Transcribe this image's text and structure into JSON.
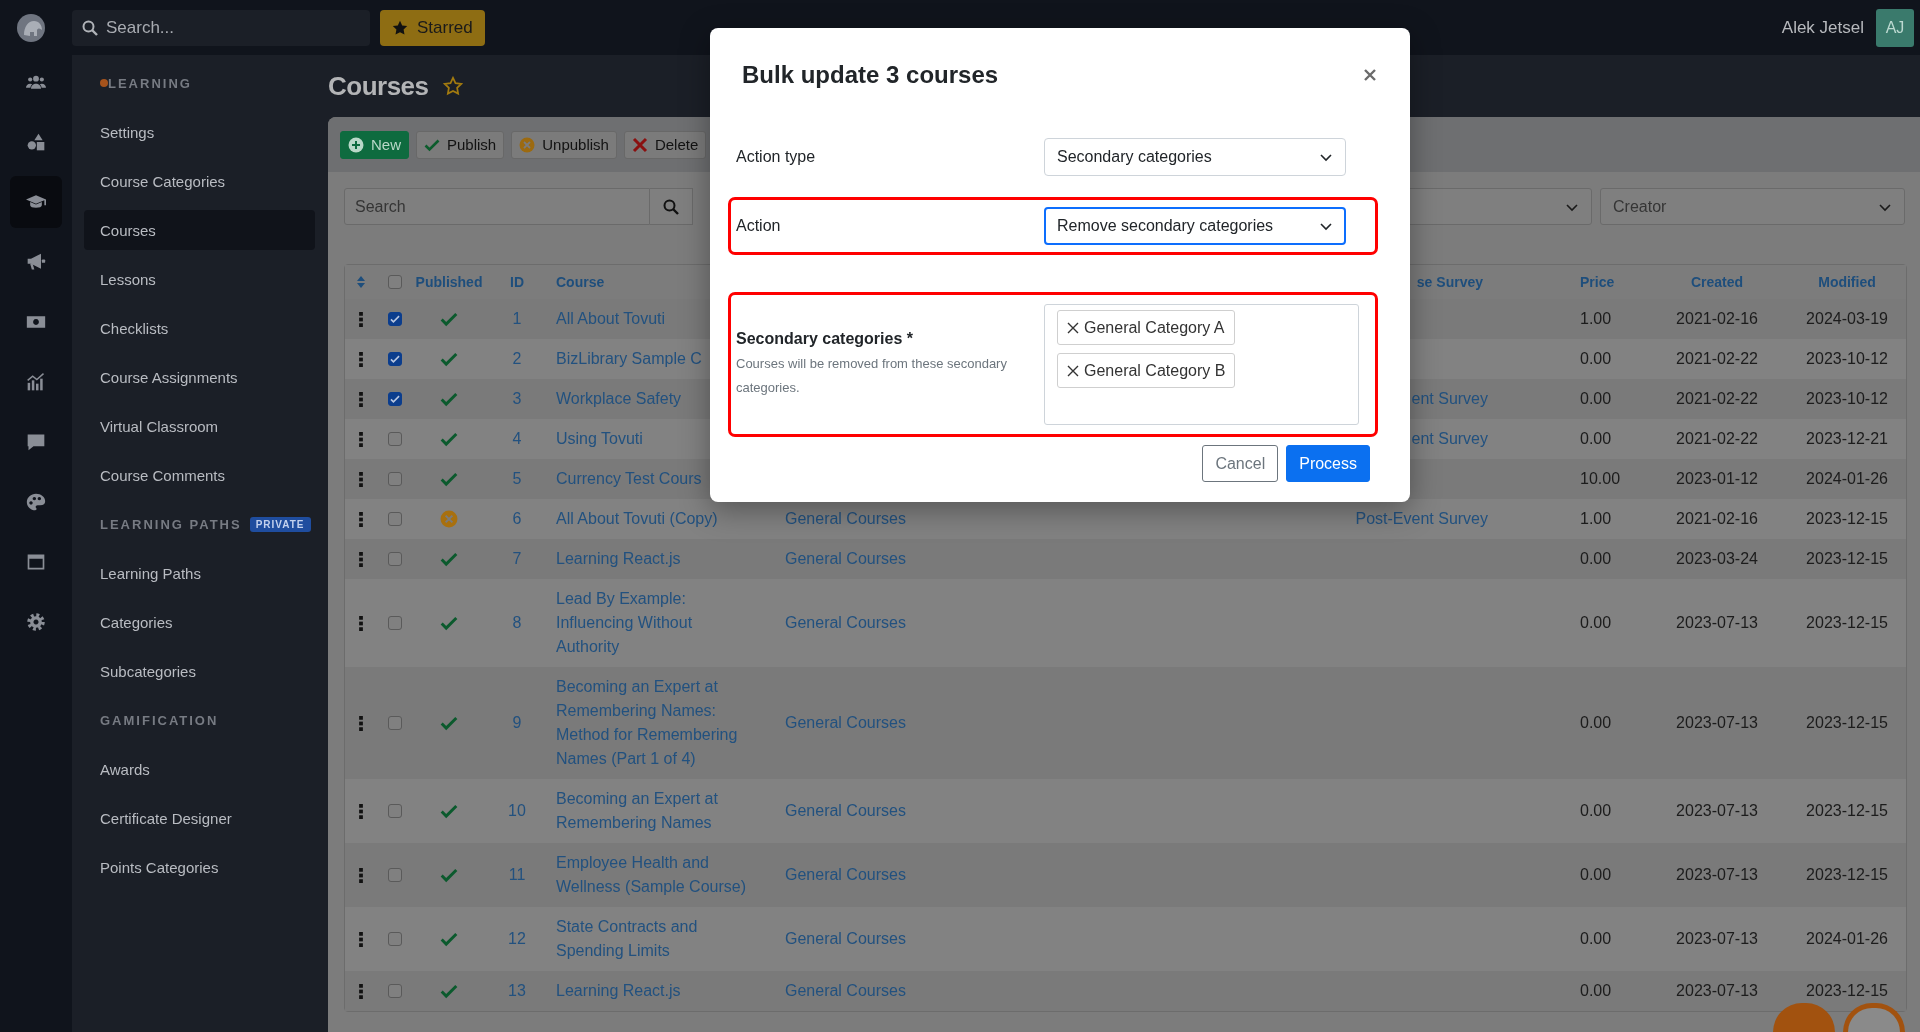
{
  "topbar": {
    "search_placeholder": "Search...",
    "starred_button": "Starred",
    "user_name": "Alek Jetsel",
    "user_initials": "AJ"
  },
  "rail": [
    {
      "selected": false
    },
    {
      "selected": false
    },
    {
      "selected": true
    },
    {
      "selected": false
    },
    {
      "selected": false
    },
    {
      "selected": false
    },
    {
      "selected": false
    },
    {
      "selected": false
    },
    {
      "selected": false
    },
    {
      "selected": false
    }
  ],
  "sidebar": {
    "sections": [
      {
        "heading": "LEARNING",
        "current": true,
        "items": [
          {
            "label": "Settings",
            "selected": false
          },
          {
            "label": "Course Categories",
            "selected": false
          },
          {
            "label": "Courses",
            "selected": true
          },
          {
            "label": "Lessons",
            "selected": false
          },
          {
            "label": "Checklists",
            "selected": false
          },
          {
            "label": "Course Assignments",
            "selected": false
          },
          {
            "label": "Virtual Classroom",
            "selected": false
          },
          {
            "label": "Course Comments",
            "selected": false
          }
        ]
      },
      {
        "heading": "LEARNING PATHS",
        "badge": "PRIVATE",
        "current": false,
        "items": [
          {
            "label": "Learning Paths",
            "selected": false
          },
          {
            "label": "Categories",
            "selected": false
          },
          {
            "label": "Subcategories",
            "selected": false
          }
        ]
      },
      {
        "heading": "GAMIFICATION",
        "current": false,
        "items": [
          {
            "label": "Awards",
            "selected": false
          },
          {
            "label": "Certificate Designer",
            "selected": false
          },
          {
            "label": "Points Categories",
            "selected": false
          }
        ]
      }
    ]
  },
  "page": {
    "title": "Courses"
  },
  "toolbar": [
    {
      "label": "New",
      "kind": "new"
    },
    {
      "label": "Publish",
      "kind": "publish"
    },
    {
      "label": "Unpublish",
      "kind": "unpublish"
    },
    {
      "label": "Delete",
      "kind": "delete"
    }
  ],
  "filters": {
    "search_placeholder": "Search",
    "creator_placeholder": "Creator"
  },
  "table": {
    "select_all": {
      "checked": false
    },
    "columns": {
      "published": "Published",
      "id": "ID",
      "course": "Course",
      "survey": "se Survey",
      "price": "Price",
      "created": "Created",
      "modified": "Modified"
    },
    "rows": [
      {
        "checked": true,
        "published": true,
        "id": "1",
        "course": "All About Tovuti",
        "price": "1.00",
        "created": "2021-02-16",
        "modified": "2024-03-19"
      },
      {
        "checked": true,
        "published": true,
        "id": "2",
        "course": "BizLibrary Sample C",
        "price": "0.00",
        "created": "2021-02-22",
        "modified": "2023-10-12"
      },
      {
        "checked": true,
        "published": true,
        "id": "3",
        "course": "Workplace Safety",
        "survey": "ent Survey",
        "price": "0.00",
        "created": "2021-02-22",
        "modified": "2023-10-12"
      },
      {
        "checked": false,
        "published": true,
        "id": "4",
        "course": "Using Tovuti",
        "survey": "ent Survey",
        "price": "0.00",
        "created": "2021-02-22",
        "modified": "2023-12-21"
      },
      {
        "checked": false,
        "published": true,
        "id": "5",
        "course": "Currency Test Cours",
        "price": "10.00",
        "created": "2023-01-12",
        "modified": "2024-01-26"
      },
      {
        "checked": false,
        "published": false,
        "id": "6",
        "course": "All About Tovuti (Copy)",
        "category": "General Courses",
        "survey": "Post-Event Survey",
        "price": "1.00",
        "created": "2021-02-16",
        "modified": "2023-12-15"
      },
      {
        "checked": false,
        "published": true,
        "id": "7",
        "course": "Learning React.js",
        "category": "General Courses",
        "price": "0.00",
        "created": "2023-03-24",
        "modified": "2023-12-15"
      },
      {
        "checked": false,
        "published": true,
        "id": "8",
        "course": "Lead By Example: Influencing Without Authority",
        "category": "General Courses",
        "price": "0.00",
        "created": "2023-07-13",
        "modified": "2023-12-15"
      },
      {
        "checked": false,
        "published": true,
        "id": "9",
        "course": "Becoming an Expert at Remembering Names: Method for Remembering Names (Part 1 of 4)",
        "category": "General Courses",
        "price": "0.00",
        "created": "2023-07-13",
        "modified": "2023-12-15"
      },
      {
        "checked": false,
        "published": true,
        "id": "10",
        "course": "Becoming an Expert at Remembering Names",
        "category": "General Courses",
        "price": "0.00",
        "created": "2023-07-13",
        "modified": "2023-12-15"
      },
      {
        "checked": false,
        "published": true,
        "id": "11",
        "course": "Employee Health and Wellness (Sample Course)",
        "category": "General Courses",
        "price": "0.00",
        "created": "2023-07-13",
        "modified": "2023-12-15"
      },
      {
        "checked": false,
        "published": true,
        "id": "12",
        "course": "State Contracts and Spending Limits",
        "category": "General Courses",
        "price": "0.00",
        "created": "2023-07-13",
        "modified": "2024-01-26"
      },
      {
        "checked": false,
        "published": true,
        "id": "13",
        "course": "Learning React.js",
        "category": "General Courses",
        "price": "0.00",
        "created": "2023-07-13",
        "modified": "2023-12-15"
      }
    ]
  },
  "modal": {
    "title": "Bulk update 3 courses",
    "fields": [
      {
        "kind": "select",
        "label": "Action type",
        "value": "Secondary categories",
        "focused": false,
        "highlighted": false
      },
      {
        "kind": "select",
        "label": "Action",
        "value": "Remove secondary categories",
        "focused": true,
        "highlighted": true
      },
      {
        "kind": "multiselect",
        "label": "Secondary categories *",
        "help": "Courses will be removed from these secondary categories.",
        "tags": [
          "General Category A",
          "General Category B"
        ],
        "highlighted": true
      }
    ],
    "buttons": [
      {
        "label": "Cancel",
        "kind": "secondary"
      },
      {
        "label": "Process",
        "kind": "primary"
      }
    ]
  }
}
